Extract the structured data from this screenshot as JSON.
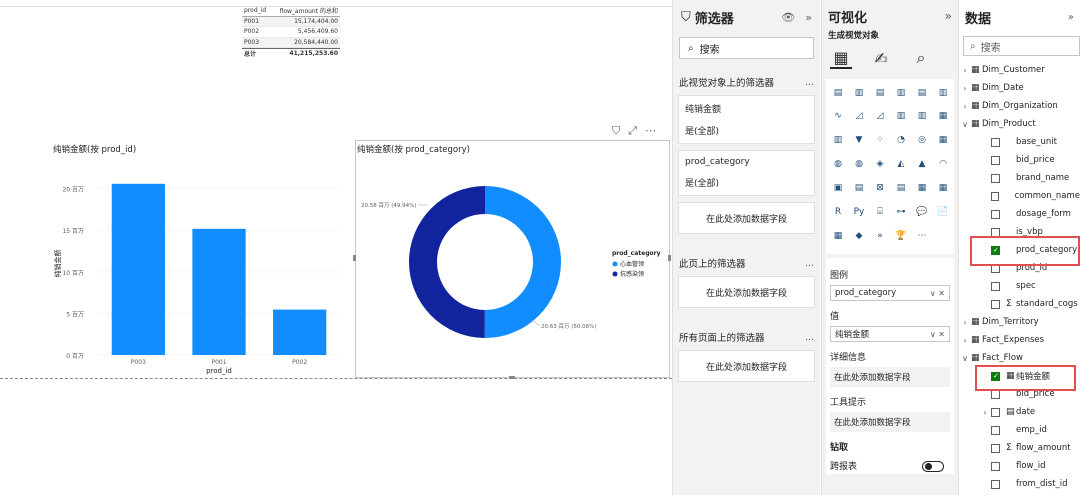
{
  "table": {
    "headers": [
      "prod_id",
      "flow_amount 的总和"
    ],
    "rows": [
      [
        "P001",
        "15,174,404.00"
      ],
      [
        "P002",
        "5,456,409.60"
      ],
      [
        "P003",
        "20,584,440.00"
      ]
    ],
    "total": [
      "总计",
      "41,215,253.60"
    ]
  },
  "bar_title": "纯销金额(按 prod_id)",
  "donut_title": "纯销金额(按 prod_category)",
  "chart_data": [
    {
      "type": "bar",
      "title": "纯销金额(按 prod_id)",
      "categories": [
        "P003",
        "P001",
        "P002"
      ],
      "values": [
        20.58,
        15.17,
        5.46
      ],
      "xlabel": "prod_id",
      "ylabel": "纯销金额",
      "yticks": [
        "0 百万",
        "5 百万",
        "10 百万",
        "15 百万",
        "20 百万"
      ],
      "ylim": [
        0,
        22
      ],
      "color": "#118dff"
    },
    {
      "type": "pie",
      "title": "纯销金额(按 prod_category)",
      "legend_title": "prod_category",
      "slices": [
        {
          "name": "心血管领",
          "value": 20.63,
          "label": "20.63 百万 (50.06%)",
          "color": "#118dff"
        },
        {
          "name": "抗感染领",
          "value": 20.58,
          "label": "20.58 百万 (49.94%)",
          "color": "#12239e"
        }
      ]
    }
  ],
  "filters": {
    "title": "筛选器",
    "search_placeholder": "搜索",
    "visual_section": "此视觉对象上的筛选器",
    "cards": [
      {
        "field": "纯销金额",
        "value": "是(全部)"
      },
      {
        "field": "prod_category",
        "value": "是(全部)"
      }
    ],
    "add_field": "在此处添加数据字段",
    "page_section": "此页上的筛选器",
    "all_pages_section": "所有页面上的筛选器",
    "more": "..."
  },
  "viz": {
    "title": "可视化",
    "subtitle": "生成视觉对象",
    "legend_label": "图例",
    "legend_field": "prod_category",
    "values_label": "值",
    "values_field": "纯销金额",
    "details_label": "详细信息",
    "details_add": "在此处添加数据字段",
    "tooltips_label": "工具提示",
    "tooltips_add": "在此处添加数据字段",
    "drill_label": "钻取",
    "cross_report": "跨报表",
    "icons": [
      "stacked-bar",
      "stacked-column",
      "clustered-bar",
      "clustered-column",
      "100-bar",
      "100-column",
      "line",
      "area",
      "stacked-area",
      "line-column",
      "line-clustered",
      "ribbon",
      "waterfall",
      "funnel",
      "scatter",
      "pie",
      "donut",
      "treemap",
      "map",
      "filled-map",
      "shape-map",
      "azure-map",
      "arcgis",
      "gauge",
      "card",
      "multirow-card",
      "kpi",
      "slicer",
      "table",
      "matrix",
      "r-visual",
      "python",
      "key-influencers",
      "decomp-tree",
      "qa",
      "smart-narrative",
      "paginated",
      "power-apps",
      "power-automate",
      "metrics",
      "more"
    ],
    "icon_glyphs": [
      "▤",
      "▥",
      "▤",
      "▥",
      "▤",
      "▥",
      "∿",
      "◿",
      "◿",
      "▥",
      "▥",
      "▦",
      "▥",
      "▼",
      "⁘",
      "◔",
      "◎",
      "▦",
      "◍",
      "◍",
      "◈",
      "◭",
      "▲",
      "◠",
      "▣",
      "▤",
      "⊠",
      "▤",
      "▦",
      "▦",
      "R",
      "Py",
      "⌸",
      "⊶",
      "💬",
      "📄",
      "▦",
      "◆",
      "»",
      "🏆",
      "⋯"
    ]
  },
  "data": {
    "title": "数据",
    "search_placeholder": "搜索",
    "tables": [
      {
        "name": "Dim_Customer",
        "expanded": false
      },
      {
        "name": "Dim_Date",
        "expanded": false
      },
      {
        "name": "Dim_Organization",
        "expanded": false
      },
      {
        "name": "Dim_Product",
        "expanded": true,
        "fields": [
          {
            "name": "base_unit",
            "checked": false,
            "sigma": false
          },
          {
            "name": "bid_price",
            "checked": false,
            "sigma": false
          },
          {
            "name": "brand_name",
            "checked": false,
            "sigma": false
          },
          {
            "name": "common_name",
            "checked": false,
            "sigma": false
          },
          {
            "name": "dosage_form",
            "checked": false,
            "sigma": false
          },
          {
            "name": "is_vbp",
            "checked": false,
            "sigma": false
          },
          {
            "name": "prod_category",
            "checked": true,
            "sigma": false
          },
          {
            "name": "prod_id",
            "checked": false,
            "sigma": false
          },
          {
            "name": "spec",
            "checked": false,
            "sigma": false
          },
          {
            "name": "standard_cogs",
            "checked": false,
            "sigma": true
          }
        ]
      },
      {
        "name": "Dim_Territory",
        "expanded": false
      },
      {
        "name": "Fact_Expenses",
        "expanded": false
      },
      {
        "name": "Fact_Flow",
        "expanded": true,
        "fields": [
          {
            "name": "纯销金额",
            "checked": true,
            "sigma": false,
            "measure": true
          },
          {
            "name": "bid_price",
            "checked": false,
            "sigma": false
          },
          {
            "name": "date",
            "checked": false,
            "sigma": false,
            "hier": true
          },
          {
            "name": "emp_id",
            "checked": false,
            "sigma": false
          },
          {
            "name": "flow_amount",
            "checked": false,
            "sigma": true
          },
          {
            "name": "flow_id",
            "checked": false,
            "sigma": false
          },
          {
            "name": "from_dist_id",
            "checked": false,
            "sigma": false
          }
        ]
      }
    ]
  }
}
